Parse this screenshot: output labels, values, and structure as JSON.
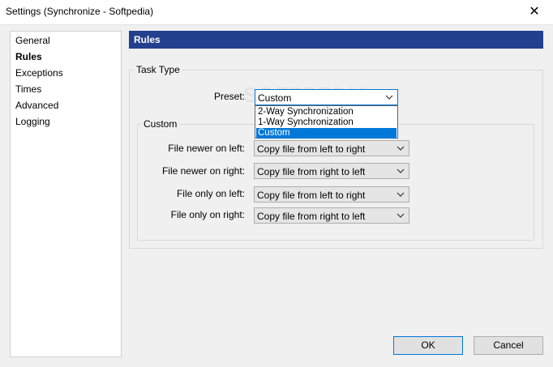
{
  "window": {
    "title": "Settings (Synchronize - Softpedia)",
    "close_glyph": "✕"
  },
  "nav": {
    "items": [
      {
        "label": "General",
        "selected": false
      },
      {
        "label": "Rules",
        "selected": true
      },
      {
        "label": "Exceptions",
        "selected": false
      },
      {
        "label": "Times",
        "selected": false
      },
      {
        "label": "Advanced",
        "selected": false
      },
      {
        "label": "Logging",
        "selected": false
      }
    ]
  },
  "header": {
    "title": "Rules",
    "bg_color": "#23408e"
  },
  "task_type": {
    "group_label": "Task Type",
    "preset_label": "Preset:",
    "preset_value": "Custom",
    "dropdown_options": [
      "2-Way Synchronization",
      "1-Way Synchronization",
      "Custom"
    ],
    "highlighted_option": "Custom"
  },
  "custom": {
    "group_label": "Custom",
    "rows": [
      {
        "label": "File newer on left:",
        "value": "Copy file from left to right"
      },
      {
        "label": "File newer on right:",
        "value": "Copy file from right to left"
      },
      {
        "label": "File only on left:",
        "value": "Copy file from left to right"
      },
      {
        "label": "File only on right:",
        "value": "Copy file from right to left"
      }
    ]
  },
  "watermark": "SOFTPEDIA",
  "buttons": {
    "ok": "OK",
    "cancel": "Cancel"
  },
  "colors": {
    "accent": "#0078d7"
  }
}
